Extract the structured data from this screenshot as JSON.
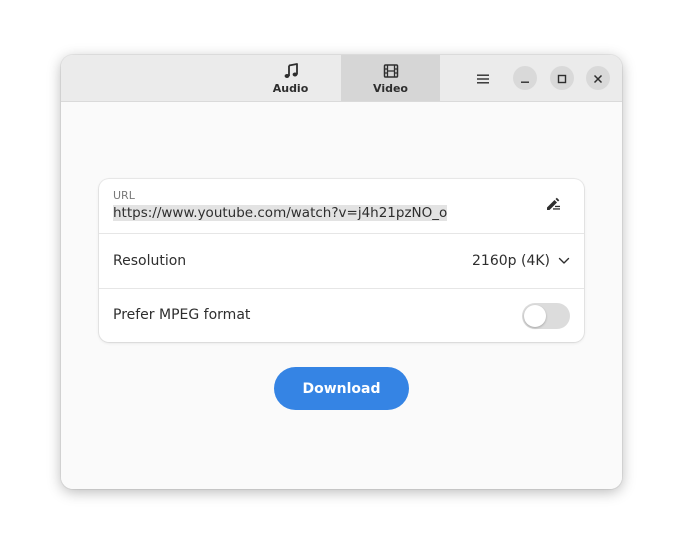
{
  "header": {
    "tabs": [
      {
        "label": "Audio",
        "icon": "music-note-icon",
        "active": false
      },
      {
        "label": "Video",
        "icon": "film-icon",
        "active": true
      }
    ],
    "menu_icon": "hamburger-menu-icon",
    "window_controls": [
      "minimize-icon",
      "maximize-icon",
      "close-icon"
    ]
  },
  "form": {
    "url": {
      "label": "URL",
      "value": "https://www.youtube.com/watch?v=j4h21pzNO_o",
      "edit_icon": "edit-pencil-icon"
    },
    "resolution": {
      "label": "Resolution",
      "selected": "2160p (4K)",
      "icon": "chevron-down-icon"
    },
    "prefer_mpeg": {
      "label": "Prefer MPEG format",
      "enabled": false
    }
  },
  "actions": {
    "download_label": "Download"
  },
  "colors": {
    "accent": "#3584e4",
    "headerbar": "#ebebeb",
    "active_tab": "#d6d6d6"
  }
}
